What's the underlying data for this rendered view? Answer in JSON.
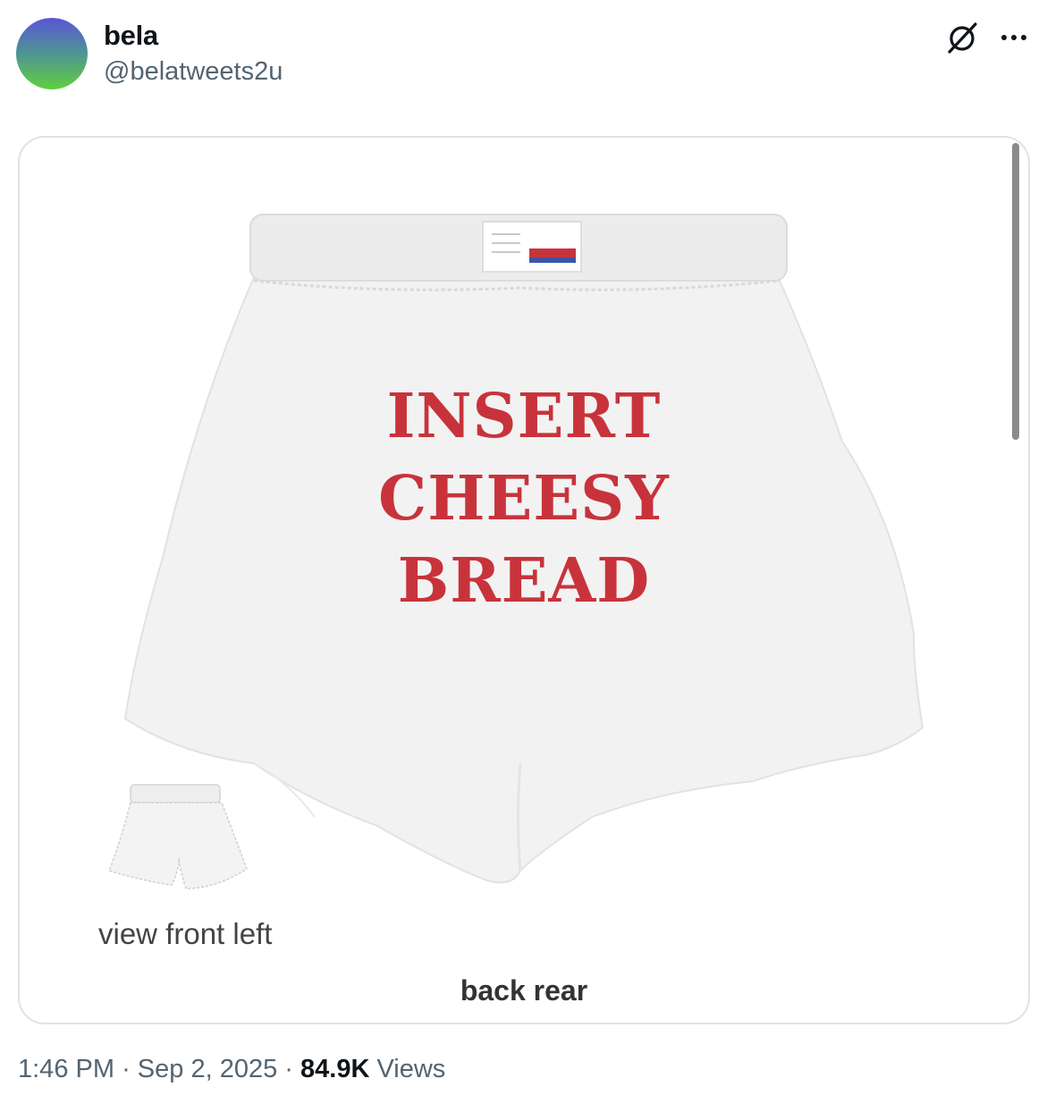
{
  "author": {
    "name": "bela",
    "handle": "@belatweets2u"
  },
  "icons": {
    "grok": "grok-icon",
    "more": "more-icon"
  },
  "media": {
    "print_lines": [
      "INSERT",
      "CHEESY",
      "BREAD"
    ],
    "caption_front": "view front left",
    "caption_back": "back rear",
    "print_color": "#c8333b"
  },
  "meta": {
    "time": "1:46 PM",
    "separator": "·",
    "date": "Sep 2, 2025",
    "views_count": "84.9K",
    "views_label": "Views"
  }
}
